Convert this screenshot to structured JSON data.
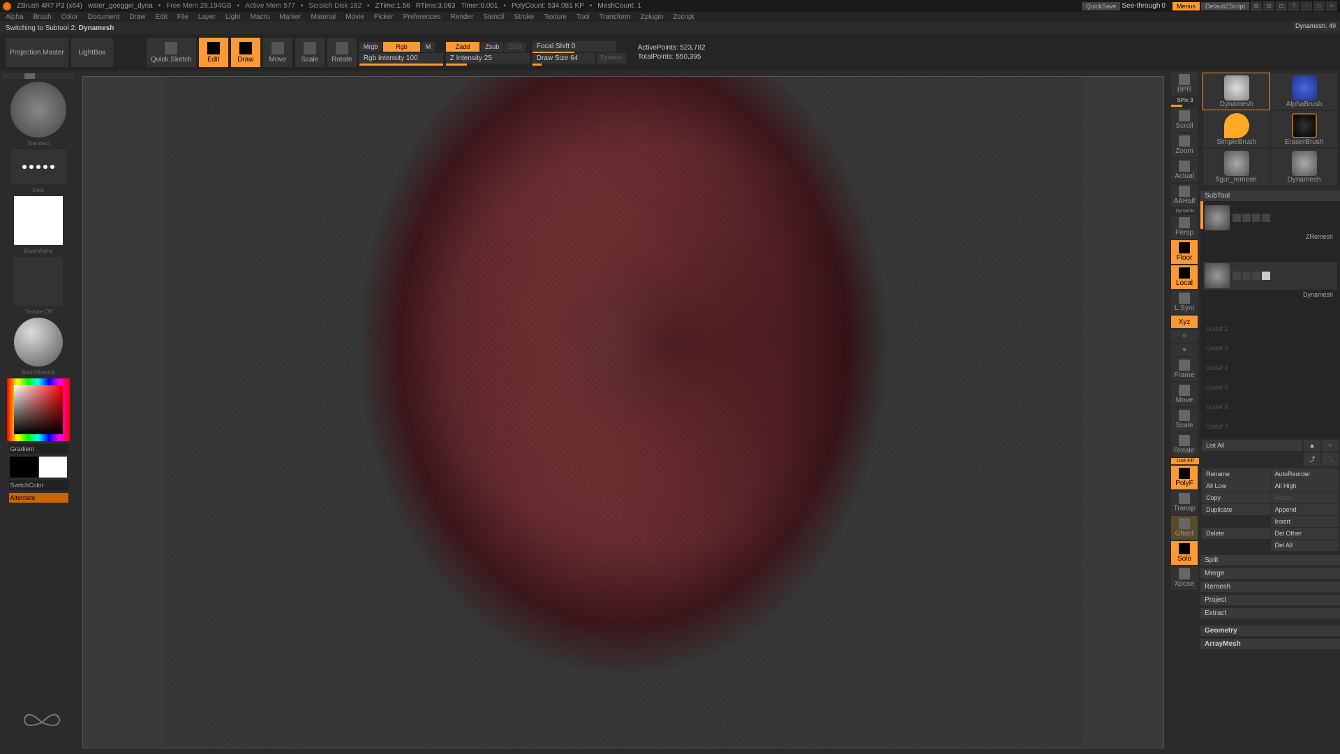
{
  "titlebar": {
    "app": "ZBrush 4R7 P3 (x64)",
    "file": "water_goeggel_dyna",
    "mem_free": "Free Mem 28.194GB",
    "mem_active": "Active Mem 577",
    "scratch": "Scratch Disk 182",
    "ztime": "ZTime:1.56",
    "rtime": "RTime:3.063",
    "timer": "Timer:0.001",
    "polycount": "PolyCount: 534.081 KP",
    "meshcount": "MeshCount: 1",
    "quicksave": "QuickSave",
    "seethrough": "See-through",
    "seethrough_val": "0",
    "menus": "Menus",
    "mode": "DefaultZScript"
  },
  "menubar": [
    "Alpha",
    "Brush",
    "Color",
    "Document",
    "Draw",
    "Edit",
    "File",
    "Layer",
    "Light",
    "Macro",
    "Marker",
    "Material",
    "Movie",
    "Picker",
    "Preferences",
    "Render",
    "Stencil",
    "Stroke",
    "Texture",
    "Tool",
    "Transform",
    "Zplugin",
    "Zscript"
  ],
  "tool_header": "Dynamesh. 49",
  "status": {
    "prefix": "Switching to Subtool 2:",
    "tool": "Dynamesh"
  },
  "toolbar": {
    "projection": "Projection\nMaster",
    "lightbox": "LightBox",
    "quicksketch": "Quick\nSketch",
    "edit": "Edit",
    "draw": "Draw",
    "move": "Move",
    "scale": "Scale",
    "rotate": "Rotate",
    "mrgb": "Mrgb",
    "rgb": "Rgb",
    "m": "M",
    "rgb_intensity": "Rgb Intensity 100",
    "zadd": "Zadd",
    "zsub": "Zsub",
    "zcut": "Zcut",
    "z_intensity": "Z Intensity 25",
    "focal_shift": "Focal Shift 0",
    "draw_size": "Draw Size 64",
    "dynamic": "Dynamic",
    "active_pts": "ActivePoints: 523,782",
    "total_pts": "TotalPoints: 550,395"
  },
  "left": {
    "brush": "Standard",
    "stroke": "Dots",
    "alpha": "BrushAlpha",
    "texture": "Texture Off",
    "material": "BasicMaterial",
    "gradient": "Gradient",
    "switchcolor": "SwitchColor",
    "alternate": "Alternate"
  },
  "shelf": {
    "bpr": "BPR",
    "spix": "SPix 3",
    "scroll": "Scroll",
    "zoom": "Zoom",
    "actual": "Actual",
    "aahalf": "AAHalf",
    "dynamic": "Dynamic",
    "persp": "Persp",
    "floor": "Floor",
    "local": "Local",
    "lsym": "L.Sym",
    "xyz": "Xyz",
    "frame": "Frame",
    "move": "Move",
    "scale": "Scale",
    "rotate": "Rotate",
    "linefill": "Line Fill",
    "polyf": "PolyF",
    "transp": "Transp",
    "ghost": "Ghost",
    "solo": "Solo",
    "xpose": "Xpose"
  },
  "tools": {
    "t1": "Dynamesh",
    "t2": "AlphaBrush",
    "t3": "SimpleBrush",
    "t4": "EraserBrush",
    "t5": "figur_remesh",
    "t6": "Dynamesh"
  },
  "subtool": {
    "header": "SubTool",
    "items": [
      "ZRemesh",
      "Dynamesh"
    ],
    "placeholders": [
      "Undef 2",
      "Undef 3",
      "Undef 4",
      "Undef 5",
      "Undef 6",
      "Undef 7"
    ],
    "list_all": "List All",
    "rename": "Rename",
    "autoreorder": "AutoReorder",
    "all_low": "All Low",
    "all_high": "All High",
    "copy": "Copy",
    "paste": "Paste",
    "duplicate": "Duplicate",
    "append": "Append",
    "insert": "Insert",
    "delete": "Delete",
    "del_other": "Del Other",
    "del_all": "Del All",
    "split": "Split",
    "merge": "Merge",
    "remesh": "Remesh",
    "project": "Project",
    "extract": "Extract",
    "geometry": "Geometry",
    "arraymesh": "ArrayMesh"
  }
}
